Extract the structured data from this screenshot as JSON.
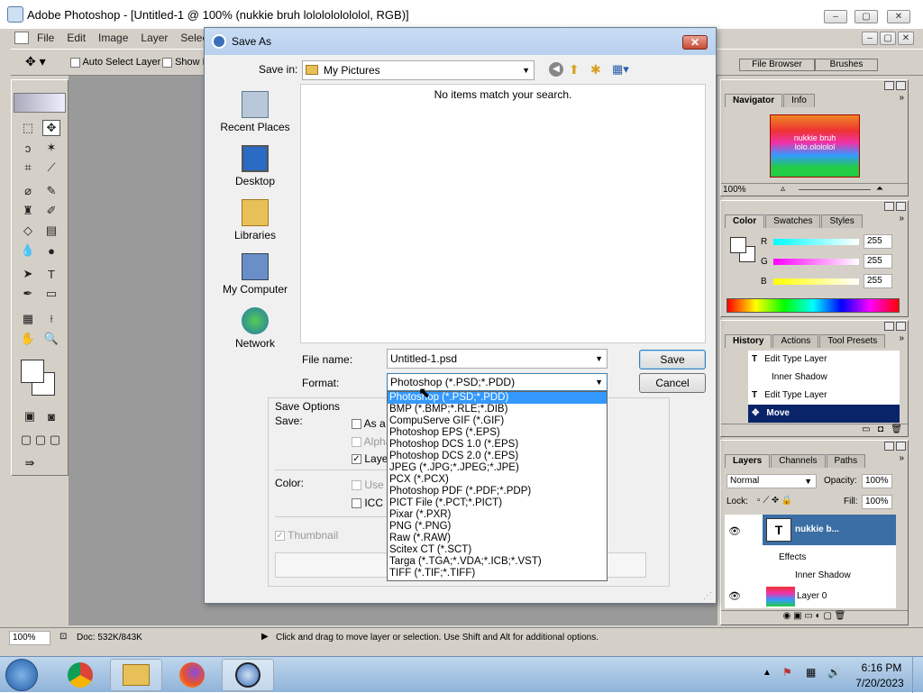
{
  "window": {
    "title": "Adobe Photoshop - [Untitled-1 @ 100% (nukkie bruh lololololololol, RGB)]",
    "min": "–",
    "max": "▢",
    "close": "✕"
  },
  "menu": [
    "File",
    "Edit",
    "Image",
    "Layer",
    "Select"
  ],
  "options": {
    "auto_select": "Auto Select Layer",
    "show_bounding": "Show B"
  },
  "palette_well": {
    "file_browser": "File Browser",
    "brushes": "Brushes"
  },
  "navigator": {
    "tabs": [
      "Navigator",
      "Info"
    ],
    "zoom": "100%",
    "thumb_text_1": "nukkie bruh",
    "thumb_text_2": "lolo.olololol"
  },
  "color": {
    "tabs": [
      "Color",
      "Swatches",
      "Styles"
    ],
    "channels": [
      {
        "label": "R",
        "value": "255"
      },
      {
        "label": "G",
        "value": "255"
      },
      {
        "label": "B",
        "value": "255"
      }
    ]
  },
  "history": {
    "tabs": [
      "History",
      "Actions",
      "Tool Presets"
    ],
    "items": [
      "Edit Type Layer",
      "Inner Shadow",
      "Edit Type Layer",
      "Move"
    ]
  },
  "layers": {
    "tabs": [
      "Layers",
      "Channels",
      "Paths"
    ],
    "blend": "Normal",
    "opacity_label": "Opacity:",
    "opacity": "100%",
    "lock_label": "Lock:",
    "fill_label": "Fill:",
    "fill": "100%",
    "rows": [
      "nukkie b...",
      "Effects",
      "Inner Shadow",
      "Layer 0"
    ]
  },
  "dialog": {
    "title": "Save As",
    "close": "✕",
    "save_in_label": "Save in:",
    "save_in": "My Pictures",
    "empty_msg": "No items match your search.",
    "places": [
      "Recent Places",
      "Desktop",
      "Libraries",
      "My Computer",
      "Network"
    ],
    "filename_label": "File name:",
    "filename": "Untitled-1.psd",
    "format_label": "Format:",
    "format": "Photoshop (*.PSD;*.PDD)",
    "save": "Save",
    "cancel": "Cancel",
    "save_options": "Save Options",
    "save_label": "Save:",
    "opt_as_copy": "As a",
    "opt_alpha": "Alpha",
    "opt_layers": "Laye",
    "color_label": "Color:",
    "opt_use": "Use",
    "opt_icc": "ICC P",
    "thumbnail": "Thumbnail",
    "formats": [
      "Photoshop (*.PSD;*.PDD)",
      "BMP (*.BMP;*.RLE;*.DIB)",
      "CompuServe GIF (*.GIF)",
      "Photoshop EPS (*.EPS)",
      "Photoshop DCS 1.0 (*.EPS)",
      "Photoshop DCS 2.0 (*.EPS)",
      "JPEG (*.JPG;*.JPEG;*.JPE)",
      "PCX (*.PCX)",
      "Photoshop PDF (*.PDF;*.PDP)",
      "PICT File (*.PCT;*.PICT)",
      "Pixar (*.PXR)",
      "PNG (*.PNG)",
      "Raw (*.RAW)",
      "Scitex CT (*.SCT)",
      "Targa (*.TGA;*.VDA;*.ICB;*.VST)",
      "TIFF (*.TIF;*.TIFF)"
    ]
  },
  "status": {
    "zoom": "100%",
    "doc": "Doc: 532K/843K",
    "hint": "Click and drag to move layer or selection.  Use Shift and Alt for additional options."
  },
  "taskbar": {
    "time": "6:16 PM",
    "date": "7/20/2023"
  }
}
